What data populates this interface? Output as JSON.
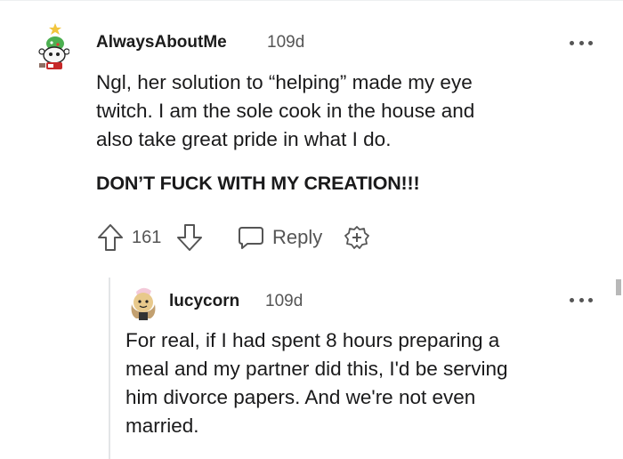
{
  "comment": {
    "author": "AlwaysAboutMe",
    "age": "109d",
    "lines": [
      "Ngl, her solution to “helping” made my eye",
      "twitch. I am the sole cook in the house and",
      "also take great pride in what I do."
    ],
    "emphasis": "DON’T FUCK WITH MY CREATION!!!",
    "score": "161",
    "reply_label": "Reply"
  },
  "reply": {
    "author": "lucycorn",
    "age": "109d",
    "lines": [
      "For real, if I had spent 8 hours preparing a",
      "meal and my partner did this, I'd be serving",
      "him divorce papers. And we're not even",
      "married."
    ]
  },
  "icons": {
    "upvote": "arrow-up-icon",
    "downvote": "arrow-down-icon",
    "reply": "speech-bubble-icon",
    "award": "add-award-icon",
    "more": "more-options-icon"
  },
  "colors": {
    "text": "#1a1a1b",
    "meta": "#555555",
    "thread_line": "#e3e5e7"
  }
}
